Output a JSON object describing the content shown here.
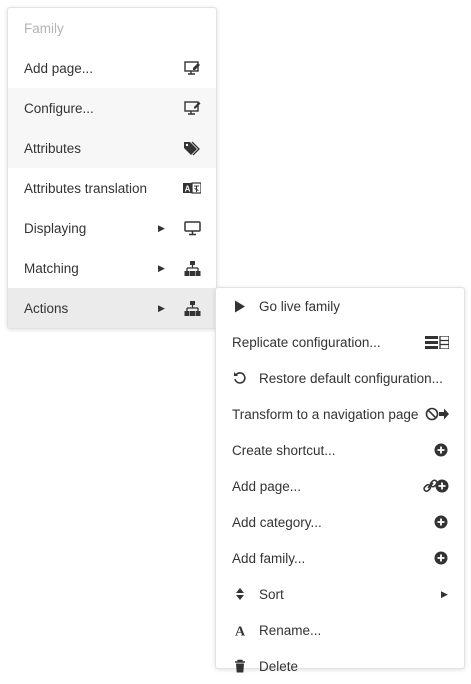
{
  "main_menu": {
    "header": "Family",
    "items": [
      {
        "label": "Add page...",
        "icon": "add-page-icon"
      },
      {
        "label": "Configure...",
        "icon": "configure-icon"
      },
      {
        "label": "Attributes",
        "icon": "tags-icon"
      },
      {
        "label": "Attributes translation",
        "icon": "translate-icon"
      },
      {
        "label": "Displaying",
        "icon": "monitor-icon",
        "submenu": true
      },
      {
        "label": "Matching",
        "icon": "sitemap-icon",
        "submenu": true
      },
      {
        "label": "Actions",
        "icon": "sitemap-icon",
        "submenu": true,
        "active": true
      }
    ]
  },
  "actions_menu": {
    "items": [
      {
        "label": "Go live family",
        "icon": "play-icon"
      },
      {
        "label": "Replicate configuration...",
        "icon": "replicate-icon"
      },
      {
        "label": "Restore default configuration...",
        "icon": "undo-icon"
      },
      {
        "label": "Transform to a navigation page",
        "icon": "ban-arrow-icon"
      },
      {
        "label": "Create shortcut...",
        "icon": "plus-circle-icon"
      },
      {
        "label": "Add page...",
        "icon": "link-plus-icon"
      },
      {
        "label": "Add category...",
        "icon": "plus-circle-icon"
      },
      {
        "label": "Add family...",
        "icon": "plus-circle-icon"
      },
      {
        "label": "Sort",
        "icon": "sort-icon",
        "submenu": true
      },
      {
        "label": "Rename...",
        "icon": "font-icon"
      },
      {
        "label": "Delete",
        "icon": "trash-icon"
      }
    ]
  },
  "colors": {
    "text": "#333333",
    "header": "#b4b4b4",
    "alt_row": "#f7f7f7",
    "active_row": "#ebebeb"
  }
}
